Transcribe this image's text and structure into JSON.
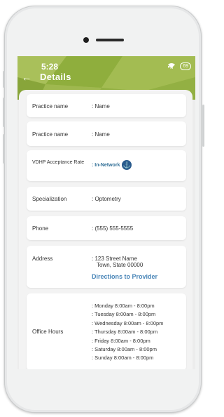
{
  "status": {
    "time": "5:28",
    "battery": "69",
    "signal": "signal-icon",
    "wifi": "wifi-icon"
  },
  "header": {
    "title": "Details",
    "back": "back-arrow-icon"
  },
  "colors": {
    "header_green": "#9ab548",
    "link_blue": "#4a86b8",
    "anchor_blue": "#2a5b8d"
  },
  "fields": [
    {
      "label": "Practice name",
      "value": ":  Name"
    },
    {
      "label": "Practice name",
      "value": ":  Name"
    },
    {
      "label": "VDHP Acceptance Rate",
      "value": ": In-Network",
      "icon": "anchor-icon"
    },
    {
      "label": "Specialization",
      "value": ": Optometry"
    },
    {
      "label": "Phone",
      "value": ":  (555) 555-5555"
    }
  ],
  "address": {
    "label": "Address",
    "line1": ":  123 Street Name",
    "line2": "Town, State 00000",
    "directions": "Directions to Provider"
  },
  "hours": {
    "label": "Office Hours",
    "days": [
      ": Monday  8:00am - 8:00pm",
      ": Tuesday  8:00am - 8:00pm",
      ": Wednesday  8:00am - 8:00pm",
      ": Thursday  8:00am - 8:00pm",
      ": Friday  8:00am - 8:00pm",
      ": Saturday  8:00am - 8:00pm",
      ": Sunday  8:00am - 8:00pm"
    ]
  }
}
